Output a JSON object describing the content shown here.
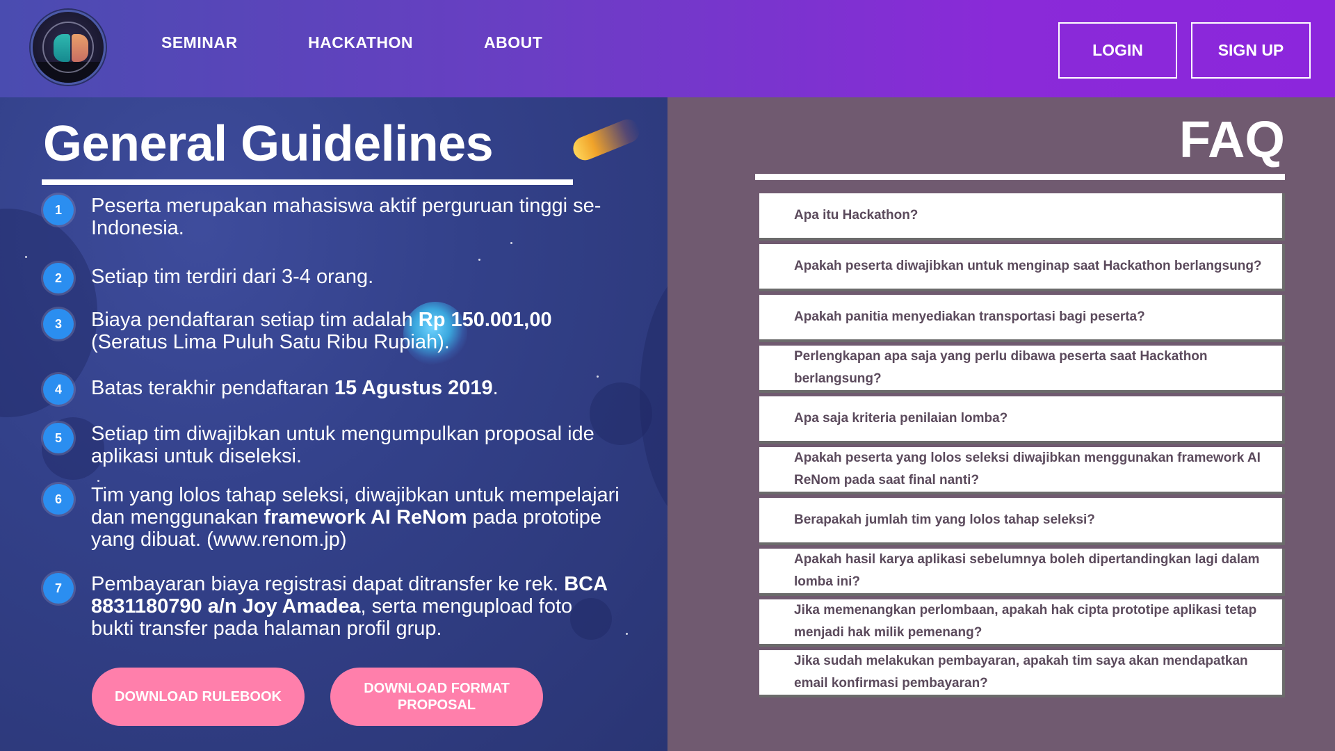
{
  "nav": {
    "links": [
      "SEMINAR",
      "HACKATHON",
      "ABOUT"
    ],
    "login": "LOGIN",
    "signup": "SIGN UP"
  },
  "guidelines": {
    "title": "General Guidelines",
    "items": [
      {
        "num": "1",
        "text": "Peserta merupakan mahasiswa aktif perguruan tinggi se-Indonesia."
      },
      {
        "num": "2",
        "text": "Setiap tim terdiri dari 3-4 orang."
      },
      {
        "num": "3",
        "pre": "Biaya pendaftaran setiap tim adalah ",
        "bold": "Rp 150.001,00",
        "post": " (Seratus Lima Puluh Satu Ribu Rupiah)."
      },
      {
        "num": "4",
        "pre": "Batas terakhir pendaftaran ",
        "bold": "15 Agustus 2019",
        "post": "."
      },
      {
        "num": "5",
        "text": "Setiap tim diwajibkan untuk mengumpulkan proposal ide aplikasi untuk diseleksi."
      },
      {
        "num": "6",
        "pre": "Tim yang lolos tahap seleksi, diwajibkan untuk mempelajari dan menggunakan ",
        "bold": "framework AI ReNom",
        "post": " pada prototipe yang dibuat. (www.renom.jp)"
      },
      {
        "num": "7",
        "pre": "Pembayaran biaya registrasi dapat ditransfer ke rek. ",
        "bold": "BCA 8831180790 a/n Joy Amadea",
        "post": ", serta mengupload foto bukti transfer pada halaman profil grup."
      }
    ],
    "download_rulebook": "DOWNLOAD RULEBOOK",
    "download_proposal": "DOWNLOAD FORMAT PROPOSAL"
  },
  "faq": {
    "title": "FAQ",
    "questions": [
      "Apa itu Hackathon?",
      "Apakah peserta diwajibkan untuk menginap saat Hackathon berlangsung?",
      "Apakah panitia menyediakan transportasi bagi peserta?",
      "Perlengkapan apa saja yang perlu dibawa peserta saat Hackathon berlangsung?",
      "Apa saja kriteria penilaian lomba?",
      "Apakah peserta yang lolos seleksi diwajibkan menggunakan framework AI ReNom pada saat final nanti?",
      "Berapakah jumlah tim yang lolos tahap seleksi?",
      "Apakah hasil karya aplikasi sebelumnya boleh dipertandingkan lagi dalam lomba ini?",
      "Jika memenangkan perlombaan, apakah hak cipta prototipe aplikasi tetap menjadi hak milik pemenang?",
      "Jika sudah melakukan pembayaran, apakah tim saya akan mendapatkan email konfirmasi pembayaran?"
    ]
  },
  "colors": {
    "accent_pink": "#ff7fab",
    "number_blue": "#2b8ef0",
    "faq_panel": "#705a70"
  }
}
